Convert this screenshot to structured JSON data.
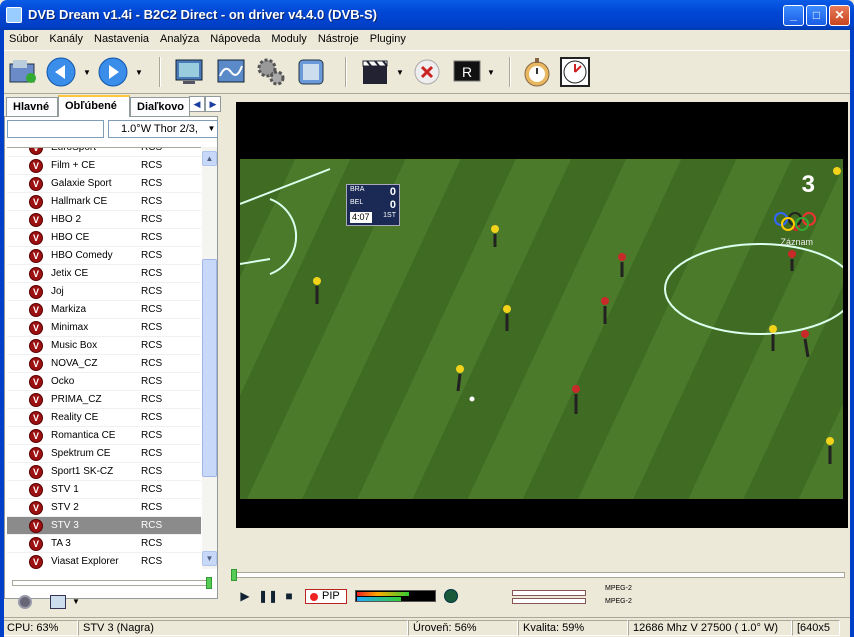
{
  "window": {
    "title": "DVB Dream v1.4i - B2C2 Direct - on driver v4.4.0 (DVB-S)",
    "min": "_",
    "max": "□",
    "close": "✕"
  },
  "menu": [
    "Súbor",
    "Kanály",
    "Nastavenia",
    "Analýza",
    "Nápoveda",
    "Moduly",
    "Nástroje",
    "Pluginy"
  ],
  "toolbar_icons": [
    "open-folder-icon",
    "back-icon",
    "forward-icon",
    "monitor-icon",
    "spectrum-icon",
    "settings-gears-icon",
    "snapshot-icon",
    "movie-clapper-icon",
    "stop-record-icon",
    "recorder-icon",
    "stopwatch-icon",
    "clock-icon"
  ],
  "tabs": [
    "Hlavné",
    "Obľúbené",
    "Diaľkovo"
  ],
  "satellite": "1.0°W Thor 2/3,",
  "channels": [
    {
      "name": "EuroSport",
      "pkg": "RCS"
    },
    {
      "name": "Film + CE",
      "pkg": "RCS"
    },
    {
      "name": "Galaxie Sport",
      "pkg": "RCS"
    },
    {
      "name": "Hallmark CE",
      "pkg": "RCS"
    },
    {
      "name": "HBO 2",
      "pkg": "RCS"
    },
    {
      "name": "HBO CE",
      "pkg": "RCS"
    },
    {
      "name": "HBO Comedy",
      "pkg": "RCS"
    },
    {
      "name": "Jetix CE",
      "pkg": "RCS"
    },
    {
      "name": "Joj",
      "pkg": "RCS"
    },
    {
      "name": "Markiza",
      "pkg": "RCS"
    },
    {
      "name": "Minimax",
      "pkg": "RCS"
    },
    {
      "name": "Music Box",
      "pkg": "RCS"
    },
    {
      "name": "NOVA_CZ",
      "pkg": "RCS"
    },
    {
      "name": "Ocko",
      "pkg": "RCS"
    },
    {
      "name": "PRIMA_CZ",
      "pkg": "RCS"
    },
    {
      "name": "Reality CE",
      "pkg": "RCS"
    },
    {
      "name": "Romantica CE",
      "pkg": "RCS"
    },
    {
      "name": "Spektrum CE",
      "pkg": "RCS"
    },
    {
      "name": "Sport1 SK-CZ",
      "pkg": "RCS"
    },
    {
      "name": "STV 1",
      "pkg": "RCS"
    },
    {
      "name": "STV 2",
      "pkg": "RCS"
    },
    {
      "name": "STV 3",
      "pkg": "RCS",
      "selected": true
    },
    {
      "name": "TA 3",
      "pkg": "RCS"
    },
    {
      "name": "Viasat Explorer",
      "pkg": "RCS"
    }
  ],
  "video": {
    "score": {
      "team1": "BRA",
      "s1": "0",
      "team2": "BEL",
      "s2": "0",
      "clock": "4:07",
      "period": "1ST"
    },
    "channel_logo": "3",
    "overlay": "Záznam"
  },
  "player": {
    "pip": "PIP",
    "mpeg1": "MPEG-2",
    "mpeg2": "MPEG-2"
  },
  "status": {
    "cpu": "CPU: 63%",
    "channel": "STV 3 (Nagra)",
    "level": "Úroveň: 56%",
    "quality": "Kvalita: 59%",
    "tuning": "12686 Mhz  V  27500  ( 1.0° W)",
    "resolution": "[640x5"
  }
}
